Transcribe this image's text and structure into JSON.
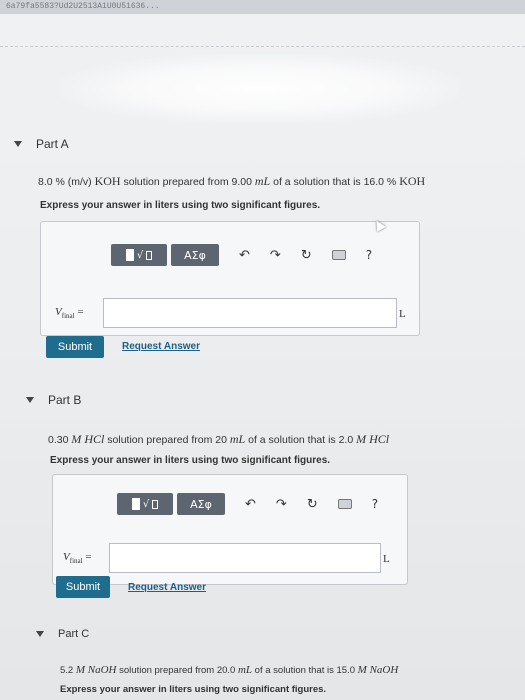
{
  "browser": {
    "url_fragment": "6a79fa5583?Ud2U2513A1U0U51636..."
  },
  "toolbar": {
    "greek_label": "ΑΣφ",
    "undo_icon": "undo-arrow-icon",
    "redo_icon": "redo-arrow-icon",
    "reset_icon": "reset-icon",
    "keyboard_icon": "keyboard-icon",
    "help_label": "?"
  },
  "parts": [
    {
      "title": "Part A",
      "question_prefix": "8.0 % (m/v) ",
      "question_compound": "KOH",
      "question_mid": " solution prepared from 9.00 ",
      "question_unit": "mL",
      "question_suffix": " of a solution that is 16.0 % ",
      "question_compound2": "KOH",
      "instruction": "Express your answer in liters using two significant figures.",
      "var_main": "V",
      "var_sub": "final",
      "var_eq": " =",
      "input_value": "",
      "unit": "L",
      "submit_label": "Submit",
      "request_label": "Request Answer"
    },
    {
      "title": "Part B",
      "question_prefix": "0.30 ",
      "question_compound": "M HCl",
      "question_mid": " solution prepared from 20 ",
      "question_unit": "mL",
      "question_suffix": " of a solution that is 2.0 ",
      "question_compound2": "M HCl",
      "instruction": "Express your answer in liters using two significant figures.",
      "var_main": "V",
      "var_sub": "final",
      "var_eq": " =",
      "input_value": "",
      "unit": "L",
      "submit_label": "Submit",
      "request_label": "Request Answer"
    },
    {
      "title": "Part C",
      "question_prefix": "5.2 ",
      "question_compound": "M NaOH",
      "question_mid": " solution prepared from 20.0 ",
      "question_unit": "mL",
      "question_suffix": " of a solution that is 15.0 ",
      "question_compound2": "M NaOH",
      "instruction": "Express your answer in liters using two significant figures."
    }
  ]
}
